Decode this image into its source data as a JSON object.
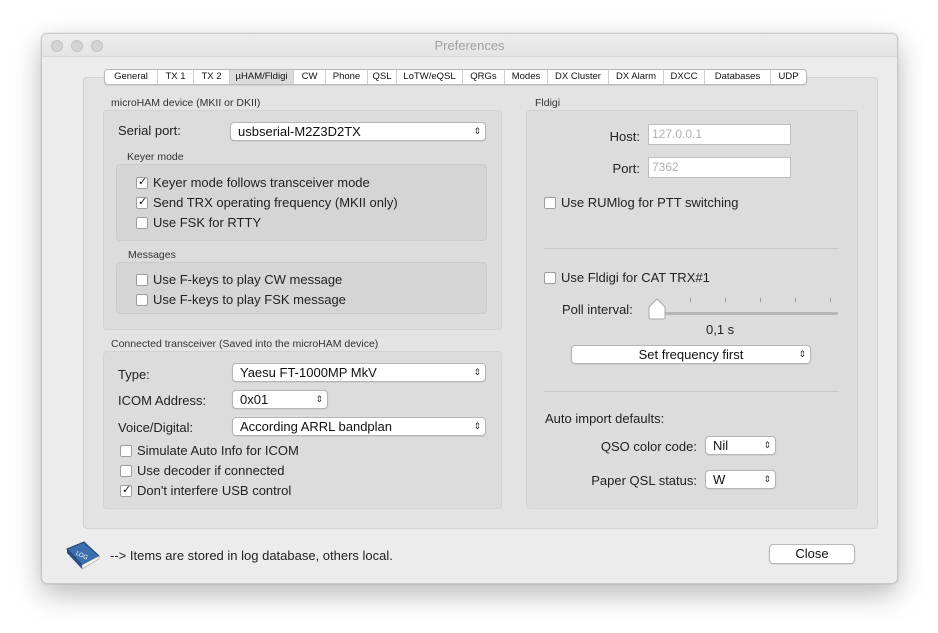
{
  "window": {
    "title": "Preferences"
  },
  "tabs": [
    "General",
    "TX 1",
    "TX 2",
    "µHAM/Fldigi",
    "CW",
    "Phone",
    "QSL",
    "LoTW/eQSL",
    "QRGs",
    "Modes",
    "DX Cluster",
    "DX Alarm",
    "DXCC",
    "Databases",
    "UDP"
  ],
  "active_tab": "µHAM/Fldigi",
  "microham": {
    "group_title": "microHAM device (MKII or DKII)",
    "serial_port_label": "Serial port:",
    "serial_port_value": "usbserial-M2Z3D2TX",
    "keyer_mode_title": "Keyer mode",
    "keyer_mode": [
      {
        "label": "Keyer mode follows transceiver mode",
        "checked": true
      },
      {
        "label": "Send TRX operating frequency (MKII only)",
        "checked": true
      },
      {
        "label": "Use FSK for RTTY",
        "checked": false
      }
    ],
    "messages_title": "Messages",
    "messages": [
      {
        "label": "Use F-keys to play CW message",
        "checked": false
      },
      {
        "label": "Use F-keys to play FSK message",
        "checked": false
      }
    ]
  },
  "transceiver": {
    "group_title": "Connected transceiver (Saved into the microHAM device)",
    "type_label": "Type:",
    "type_value": "Yaesu FT-1000MP MkV",
    "icom_label": "ICOM Address:",
    "icom_value": "0x01",
    "voice_label": "Voice/Digital:",
    "voice_value": "According ARRL bandplan",
    "options": [
      {
        "label": "Simulate Auto Info for ICOM",
        "checked": false
      },
      {
        "label": "Use decoder if connected",
        "checked": false
      },
      {
        "label": "Don't interfere USB control",
        "checked": true
      }
    ]
  },
  "fldigi": {
    "group_title": "Fldigi",
    "host_label": "Host:",
    "host_placeholder": "127.0.0.1",
    "port_label": "Port:",
    "port_placeholder": "7362",
    "ptt": {
      "label": "Use RUMlog for PTT switching",
      "checked": false
    },
    "cat": {
      "label": "Use Fldigi for CAT TRX#1",
      "checked": false
    },
    "poll_label": "Poll interval:",
    "poll_value": "0,1 s",
    "poll_position": 0,
    "freq_mode": "Set frequency first",
    "auto_import_label": "Auto import defaults:",
    "qso_color_label": "QSO color code:",
    "qso_color_value": "Nil",
    "paper_qsl_label": "Paper QSL status:",
    "paper_qsl_value": "W"
  },
  "footer": {
    "note": "--> Items are stored in log database, others local.",
    "close_label": "Close",
    "log_icon_text": "LOG"
  }
}
